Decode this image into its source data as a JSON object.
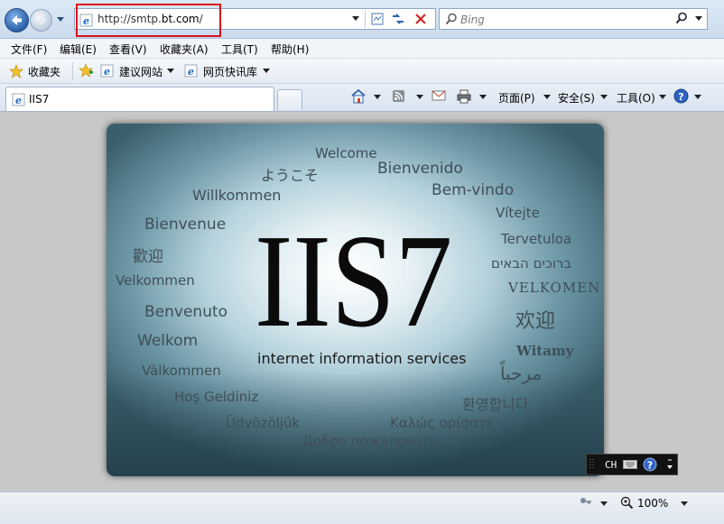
{
  "address_bar": {
    "url_prefix": "http://smtp.",
    "url_domain": "bt.com",
    "url_suffix": "/",
    "search_placeholder": "Bing"
  },
  "menu": [
    "文件(F)",
    "编辑(E)",
    "查看(V)",
    "收藏夹(A)",
    "工具(T)",
    "帮助(H)"
  ],
  "favorites_bar": {
    "favorites_label": "收藏夹",
    "suggested_sites": "建议网站",
    "web_slice_gallery": "网页快讯库"
  },
  "tab": {
    "title": "IIS7"
  },
  "command_bar": {
    "page": "页面(P)",
    "safety": "安全(S)",
    "tools": "工具(O)"
  },
  "page": {
    "title": "IIS7",
    "subtitle": "internet information services",
    "welcome_words": [
      "Welcome",
      "ようこそ",
      "Bienvenido",
      "Willkommen",
      "Bem-vindo",
      "Vítejte",
      "Bienvenue",
      "Tervetuloa",
      "歡迎",
      "ברוכים הבאים",
      "Velkommen",
      "VELKOMEN",
      "Benvenuto",
      "欢迎",
      "Welkom",
      "Witamy",
      "Välkommen",
      "مرحباً",
      "Hoş Geldiniz",
      "환영합니다",
      "Üdvözöljük",
      "Καλώς ορίσατε",
      "Добро пожаловать"
    ]
  },
  "ime_bar": {
    "label": "CH"
  },
  "status_bar": {
    "zoom": "100%"
  },
  "colors": {
    "highlight_border": "#d9141c",
    "welcome_text": "#3f4f57"
  }
}
